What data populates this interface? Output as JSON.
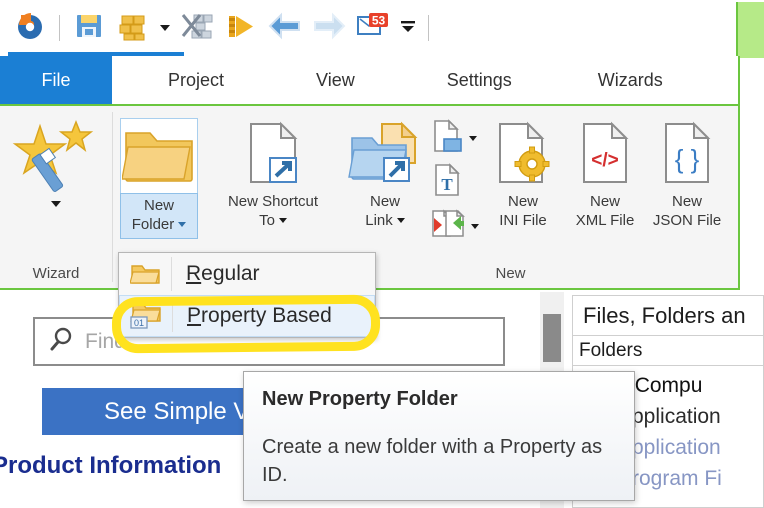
{
  "toolbar": {
    "logo": "app-logo",
    "buttons": [
      {
        "name": "save-button",
        "icon": "floppy-disk-icon",
        "label": "Save"
      },
      {
        "name": "build-button",
        "icon": "bricks-icon",
        "label": "Build"
      },
      {
        "name": "build-dropdown",
        "icon": "chevron-down-icon",
        "label": "Build options"
      },
      {
        "name": "build-and-run-button",
        "icon": "bricks-cut-icon",
        "label": "Build and Run"
      },
      {
        "name": "run-button",
        "icon": "play-arrow-icon",
        "label": "Run"
      },
      {
        "name": "back-button",
        "icon": "arrow-left-icon",
        "label": "Back"
      },
      {
        "name": "forward-button",
        "icon": "arrow-right-icon",
        "label": "Forward"
      },
      {
        "name": "messages-button",
        "icon": "messages-badge-icon",
        "label": "Messages"
      },
      {
        "name": "customize-dropdown",
        "icon": "chevron-down-icon",
        "label": "Customize"
      }
    ],
    "badge_count": "53"
  },
  "tabs": [
    {
      "label": "File",
      "active": true
    },
    {
      "label": "Project",
      "active": false
    },
    {
      "label": "View",
      "active": false
    },
    {
      "label": "Settings",
      "active": false
    },
    {
      "label": "Wizards",
      "active": false
    }
  ],
  "ribbon": {
    "groups": [
      {
        "label": "Wizard"
      },
      {
        "label": "New"
      }
    ],
    "wizard": {
      "icon": "magic-wand-stars-icon",
      "dropdown": "chevron-down-icon",
      "group_label": "Wizard"
    },
    "buttons": [
      {
        "name": "new-folder-button",
        "icon": "folder-icon",
        "line1": "New",
        "line2": "Folder",
        "has_dropdown": true,
        "pressed": true
      },
      {
        "name": "new-shortcut-to-button",
        "icon": "shortcut-file-icon",
        "line1": "New Shortcut",
        "line2": "To",
        "has_dropdown": true,
        "pressed": false
      },
      {
        "name": "new-link-button",
        "icon": "link-folder-icon",
        "line1": "New",
        "line2": "Link",
        "has_dropdown": true,
        "pressed": false
      },
      {
        "name": "new-ini-file-button",
        "icon": "ini-file-gear-icon",
        "line1": "New",
        "line2": "INI File",
        "has_dropdown": false,
        "pressed": false
      },
      {
        "name": "new-xml-file-button",
        "icon": "xml-file-icon",
        "line1": "New",
        "line2": "XML File",
        "has_dropdown": false,
        "pressed": false
      },
      {
        "name": "new-json-file-button",
        "icon": "json-file-icon",
        "line1": "New",
        "line2": "JSON File",
        "has_dropdown": false,
        "pressed": false
      }
    ],
    "small_buttons": [
      {
        "name": "new-file-button",
        "icon": "file-folder-small-icon",
        "has_dropdown": true
      },
      {
        "name": "new-text-file-button",
        "icon": "text-file-icon",
        "has_dropdown": false
      },
      {
        "name": "import-export-button",
        "icon": "import-export-arrows-icon",
        "has_dropdown": true
      }
    ]
  },
  "menu": {
    "items": [
      {
        "name": "menu-item-regular",
        "icon": "folder-icon",
        "accel": "R",
        "rest": "egular",
        "selected": false
      },
      {
        "name": "menu-item-property-based",
        "icon": "property-folder-icon",
        "accel": "P",
        "rest": "roperty Based",
        "selected": true
      }
    ]
  },
  "tooltip": {
    "title": "New Property Folder",
    "body": "Create a new folder with a Property as ID."
  },
  "left_panel": {
    "search": {
      "placeholder": "Find",
      "value": "",
      "icon": "search-icon"
    },
    "simple_view_button": "See Simple View",
    "section_heading": "Product Information"
  },
  "right_panel": {
    "title": "Files, Folders an",
    "subtitle": "Folders",
    "tree": [
      {
        "label": "arget Compu",
        "level": 0,
        "dim": false,
        "has_icon": false
      },
      {
        "label": "Application",
        "level": 1,
        "dim": false,
        "has_icon": true
      },
      {
        "label": "Application",
        "level": 1,
        "dim": true,
        "has_icon": true
      },
      {
        "label": "Program Fi",
        "level": 1,
        "dim": true,
        "has_icon": true
      }
    ]
  },
  "colors": {
    "accent_blue": "#1b7fd4",
    "button_blue": "#3b72c4",
    "highlight_yellow": "#ffe21f",
    "green_marker": "#6bc63f",
    "folder_yellow": "#f5c244",
    "badge_red": "#e8412a",
    "heading_navy": "#1a2d8f"
  }
}
